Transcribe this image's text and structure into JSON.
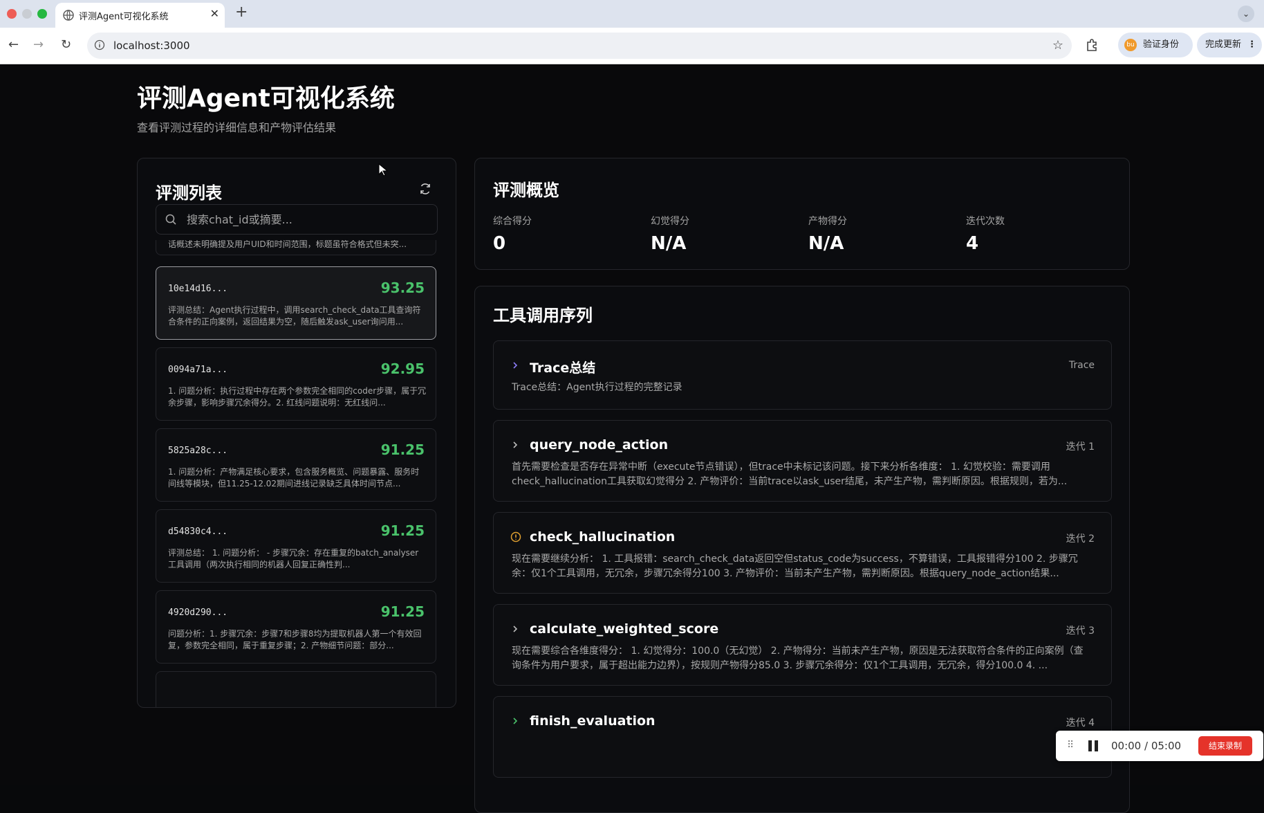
{
  "browser": {
    "tab_title": "评测Agent可视化系统",
    "tab_close": "✕",
    "new_tab": "+",
    "url": "localhost:3000",
    "verify_label": "验证身份",
    "update_label": "完成更新",
    "avatar_letter": "bu"
  },
  "page": {
    "title": "评测Agent可视化系统",
    "subtitle": "查看评测过程的详细信息和产物评估结果"
  },
  "eval_list": {
    "title": "评测列表",
    "search_placeholder": "搜索chat_id或摘要...",
    "partial_top_summary": "话概述未明确提及用户UID和时间范围，标题虽符合格式但未突...",
    "items": [
      {
        "id": "10e14d16...",
        "score": "93.25",
        "summary": "评测总结：Agent执行过程中，调用search_check_data工具查询符合条件的正向案例，返回结果为空，随后触发ask_user询问用..."
      },
      {
        "id": "0094a71a...",
        "score": "92.95",
        "summary": "1. 问题分析：执行过程中存在两个参数完全相同的coder步骤，属于冗余步骤，影响步骤冗余得分。2. 红线问题说明：无红线问..."
      },
      {
        "id": "5825a28c...",
        "score": "91.25",
        "summary": "1. 问题分析：产物满足核心要求，包含服务概览、问题暴露、服务时间线等模块，但11.25-12.02期间进线记录缺乏具体时间节点..."
      },
      {
        "id": "d54830c4...",
        "score": "91.25",
        "summary": "评测总结： 1. 问题分析： - 步骤冗余：存在重复的batch_analyser工具调用（两次执行相同的机器人回复正确性判..."
      },
      {
        "id": "4920d290...",
        "score": "91.25",
        "summary": "问题分析：1. 步骤冗余：步骤7和步骤8均为提取机器人第一个有效回复，参数完全相同，属于重复步骤；2. 产物细节问题：部分..."
      }
    ]
  },
  "overview": {
    "title": "评测概览",
    "metrics": [
      {
        "label": "综合得分",
        "value": "0"
      },
      {
        "label": "幻觉得分",
        "value": "N/A"
      },
      {
        "label": "产物得分",
        "value": "N/A"
      },
      {
        "label": "迭代次数",
        "value": "4"
      }
    ]
  },
  "tool_sequence": {
    "title": "工具调用序列",
    "items": [
      {
        "name": "Trace总结",
        "tag": "Trace",
        "icon": "chevron-right-icon",
        "desc": "Trace总结：Agent执行过程的完整记录"
      },
      {
        "name": "query_node_action",
        "tag": "迭代 1",
        "icon": "chevron-right-icon",
        "desc": "首先需要检查是否存在异常中断（execute节点错误），但trace中未标记该问题。接下来分析各维度： 1. 幻觉校验：需要调用check_hallucination工具获取幻觉得分 2. 产物评价：当前trace以ask_user结尾，未产生产物，需判断原因。根据规则，若为..."
      },
      {
        "name": "check_hallucination",
        "tag": "迭代 2",
        "icon": "warning-circle-icon",
        "desc": "现在需要继续分析： 1. 工具报错：search_check_data返回空但status_code为success，不算错误，工具报错得分100 2. 步骤冗余：仅1个工具调用，无冗余，步骤冗余得分100 3. 产物评价：当前未产生产物，需判断原因。根据query_node_action结果..."
      },
      {
        "name": "calculate_weighted_score",
        "tag": "迭代 3",
        "icon": "chevron-right-icon",
        "desc": "现在需要综合各维度得分： 1. 幻觉得分：100.0（无幻觉） 2. 产物得分：当前未产生产物，原因是无法获取符合条件的正向案例（查询条件为用户要求，属于超出能力边界），按规则产物得分85.0 3. 步骤冗余得分：仅1个工具调用，无冗余，得分100.0 4. ..."
      },
      {
        "name": "finish_evaluation",
        "tag": "迭代 4",
        "icon": "chevron-right-icon",
        "desc": ""
      }
    ]
  },
  "recorder": {
    "grip": "⠿",
    "time": "00:00 / 05:00",
    "stop_label": "结束录制"
  },
  "colors": {
    "background": "#09090b",
    "score_green": "#4ac26b",
    "warning": "#e0a030",
    "chevron": "#8b7cf6",
    "stop_red": "#e5332a"
  }
}
